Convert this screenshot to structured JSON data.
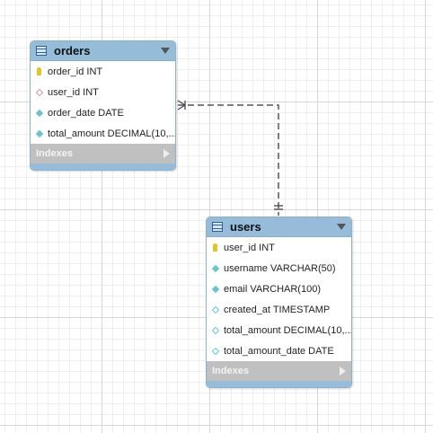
{
  "tables": {
    "orders": {
      "name": "orders",
      "columns": [
        {
          "text": "order_id INT",
          "icon": "primary-key"
        },
        {
          "text": "user_id INT",
          "icon": "foreign-key"
        },
        {
          "text": "order_date DATE",
          "icon": "not-null-column"
        },
        {
          "text": "total_amount DECIMAL(10,...",
          "icon": "not-null-column"
        }
      ],
      "indexes_label": "Indexes"
    },
    "users": {
      "name": "users",
      "columns": [
        {
          "text": "user_id INT",
          "icon": "primary-key"
        },
        {
          "text": "username VARCHAR(50)",
          "icon": "not-null-column"
        },
        {
          "text": "email VARCHAR(100)",
          "icon": "not-null-column"
        },
        {
          "text": "created_at TIMESTAMP",
          "icon": "nullable-column"
        },
        {
          "text": "total_amount DECIMAL(10,...",
          "icon": "nullable-column"
        },
        {
          "text": "total_amount_date DATE",
          "icon": "nullable-column"
        }
      ],
      "indexes_label": "Indexes"
    }
  },
  "relationship": {
    "from": "orders",
    "to": "users",
    "cardinality": "many-to-one",
    "style": "dashed"
  },
  "colors": {
    "header": "#95bcd9",
    "indexes": "#c0c0c0",
    "column_icon": "#67c6cc",
    "primary_key": "#e6c321"
  }
}
